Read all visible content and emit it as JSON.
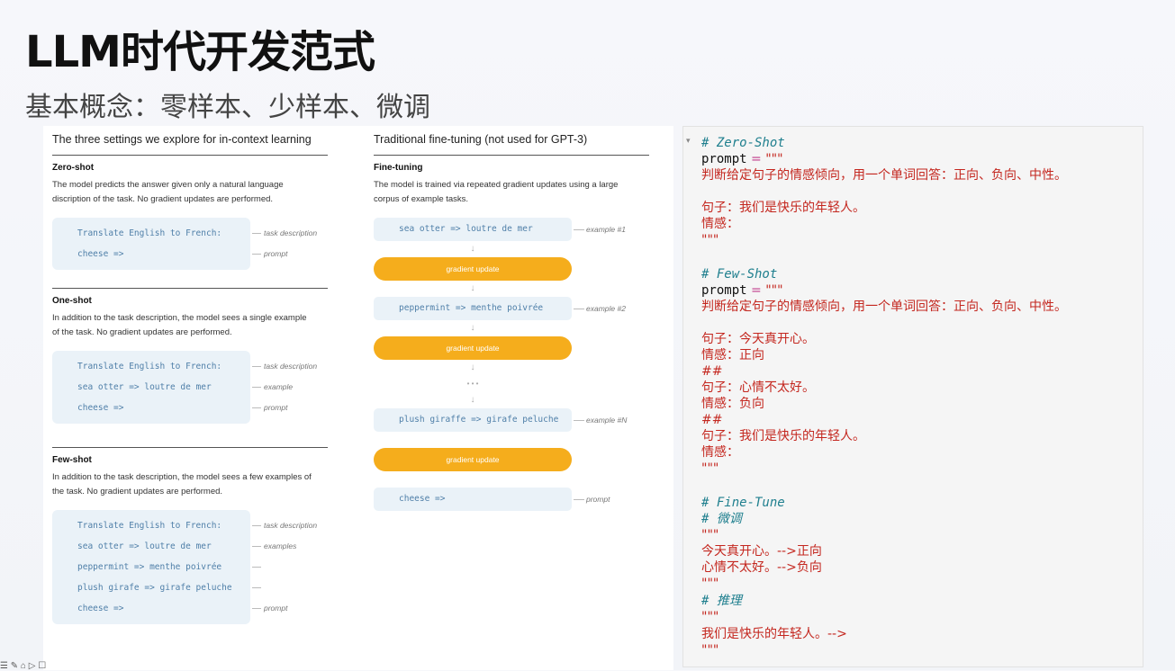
{
  "slide": {
    "title": "LLM时代开发范式",
    "subtitle": "基本概念：零样本、少样本、微调"
  },
  "figure": {
    "left_header": "The three settings we explore for in-context learning",
    "mid_header": "Traditional fine-tuning (not used for GPT-3)",
    "zero_shot": {
      "title": "Zero-shot",
      "desc": "The model predicts the answer given only a natural language discription of the task. No gradient updates are performed.",
      "lines": [
        {
          "text": "Translate English to French:",
          "tag": "task description"
        },
        {
          "text": "cheese =>",
          "tag": "prompt"
        }
      ]
    },
    "one_shot": {
      "title": "One-shot",
      "desc": "In addition to the task description, the model sees a single example of the task. No gradient updates are performed.",
      "lines": [
        {
          "text": "Translate English to French:",
          "tag": "task description"
        },
        {
          "text": "sea otter => loutre de mer",
          "tag": "example"
        },
        {
          "text": "cheese =>",
          "tag": "prompt"
        }
      ]
    },
    "few_shot": {
      "title": "Few-shot",
      "desc": "In addition to the task description, the model sees a few examples of the task. No gradient updates are performed.",
      "lines": [
        {
          "text": "Translate English to French:",
          "tag": "task description"
        },
        {
          "text": "sea otter => loutre de mer",
          "tag": "examples"
        },
        {
          "text": "peppermint => menthe poivrée",
          "tag": ""
        },
        {
          "text": "plush girafe => girafe peluche",
          "tag": ""
        },
        {
          "text": "cheese =>",
          "tag": "prompt"
        }
      ]
    },
    "fine_tuning": {
      "title": "Fine-tuning",
      "desc": "The model is trained via repeated gradient updates using a large corpus of example tasks.",
      "ex1": "sea otter => loutre de mer",
      "ex1_tag": "example #1",
      "grad": "gradient update",
      "ex2": "peppermint => menthe poivrée",
      "ex2_tag": "example #2",
      "ellipsis": "• • •",
      "exn": "plush giraffe => girafe peluche",
      "exn_tag": "example #N",
      "prompt": "cheese =>",
      "prompt_tag": "prompt"
    }
  },
  "code": {
    "kw_prompt": "prompt",
    "eq": "=",
    "triple_quote": "\"\"\"",
    "zero_comment": "# Zero-Shot",
    "instruction": "判断给定句子的情感倾向，用一个单词回答：正向、负向、中性。",
    "sent_young": "句子：我们是快乐的年轻人。",
    "emotion_label": "情感：",
    "few_comment": "# Few-Shot",
    "sent_happy": "句子：今天真开心。",
    "emotion_pos": "情感：正向",
    "hash_sep": "##",
    "sent_bad": "句子：心情不太好。",
    "emotion_neg": "情感：负向",
    "ft_comment": "# Fine-Tune",
    "ft_comment_cn": "# 微调",
    "ft_line1": "今天真开心。-->正向",
    "ft_line2": "心情不太好。-->负向",
    "infer_comment": "# 推理",
    "infer_line": "我们是快乐的年轻人。-->"
  },
  "ui": {
    "fold_icon": "▾",
    "taskbar_icons": "☰ ✎ ⌂ ▷ ☐"
  }
}
